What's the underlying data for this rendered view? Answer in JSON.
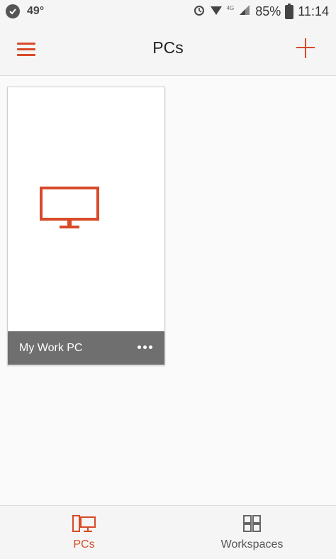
{
  "status_bar": {
    "temperature": "49°",
    "network_tag": "4G",
    "battery": "85%",
    "time": "11:14"
  },
  "app_bar": {
    "title": "PCs"
  },
  "pcs": [
    {
      "name": "My Work PC"
    }
  ],
  "bottom_nav": {
    "pcs_label": "PCs",
    "workspaces_label": "Workspaces"
  },
  "colors": {
    "accent": "#d84a28",
    "card_footer": "#6f6f6f"
  }
}
